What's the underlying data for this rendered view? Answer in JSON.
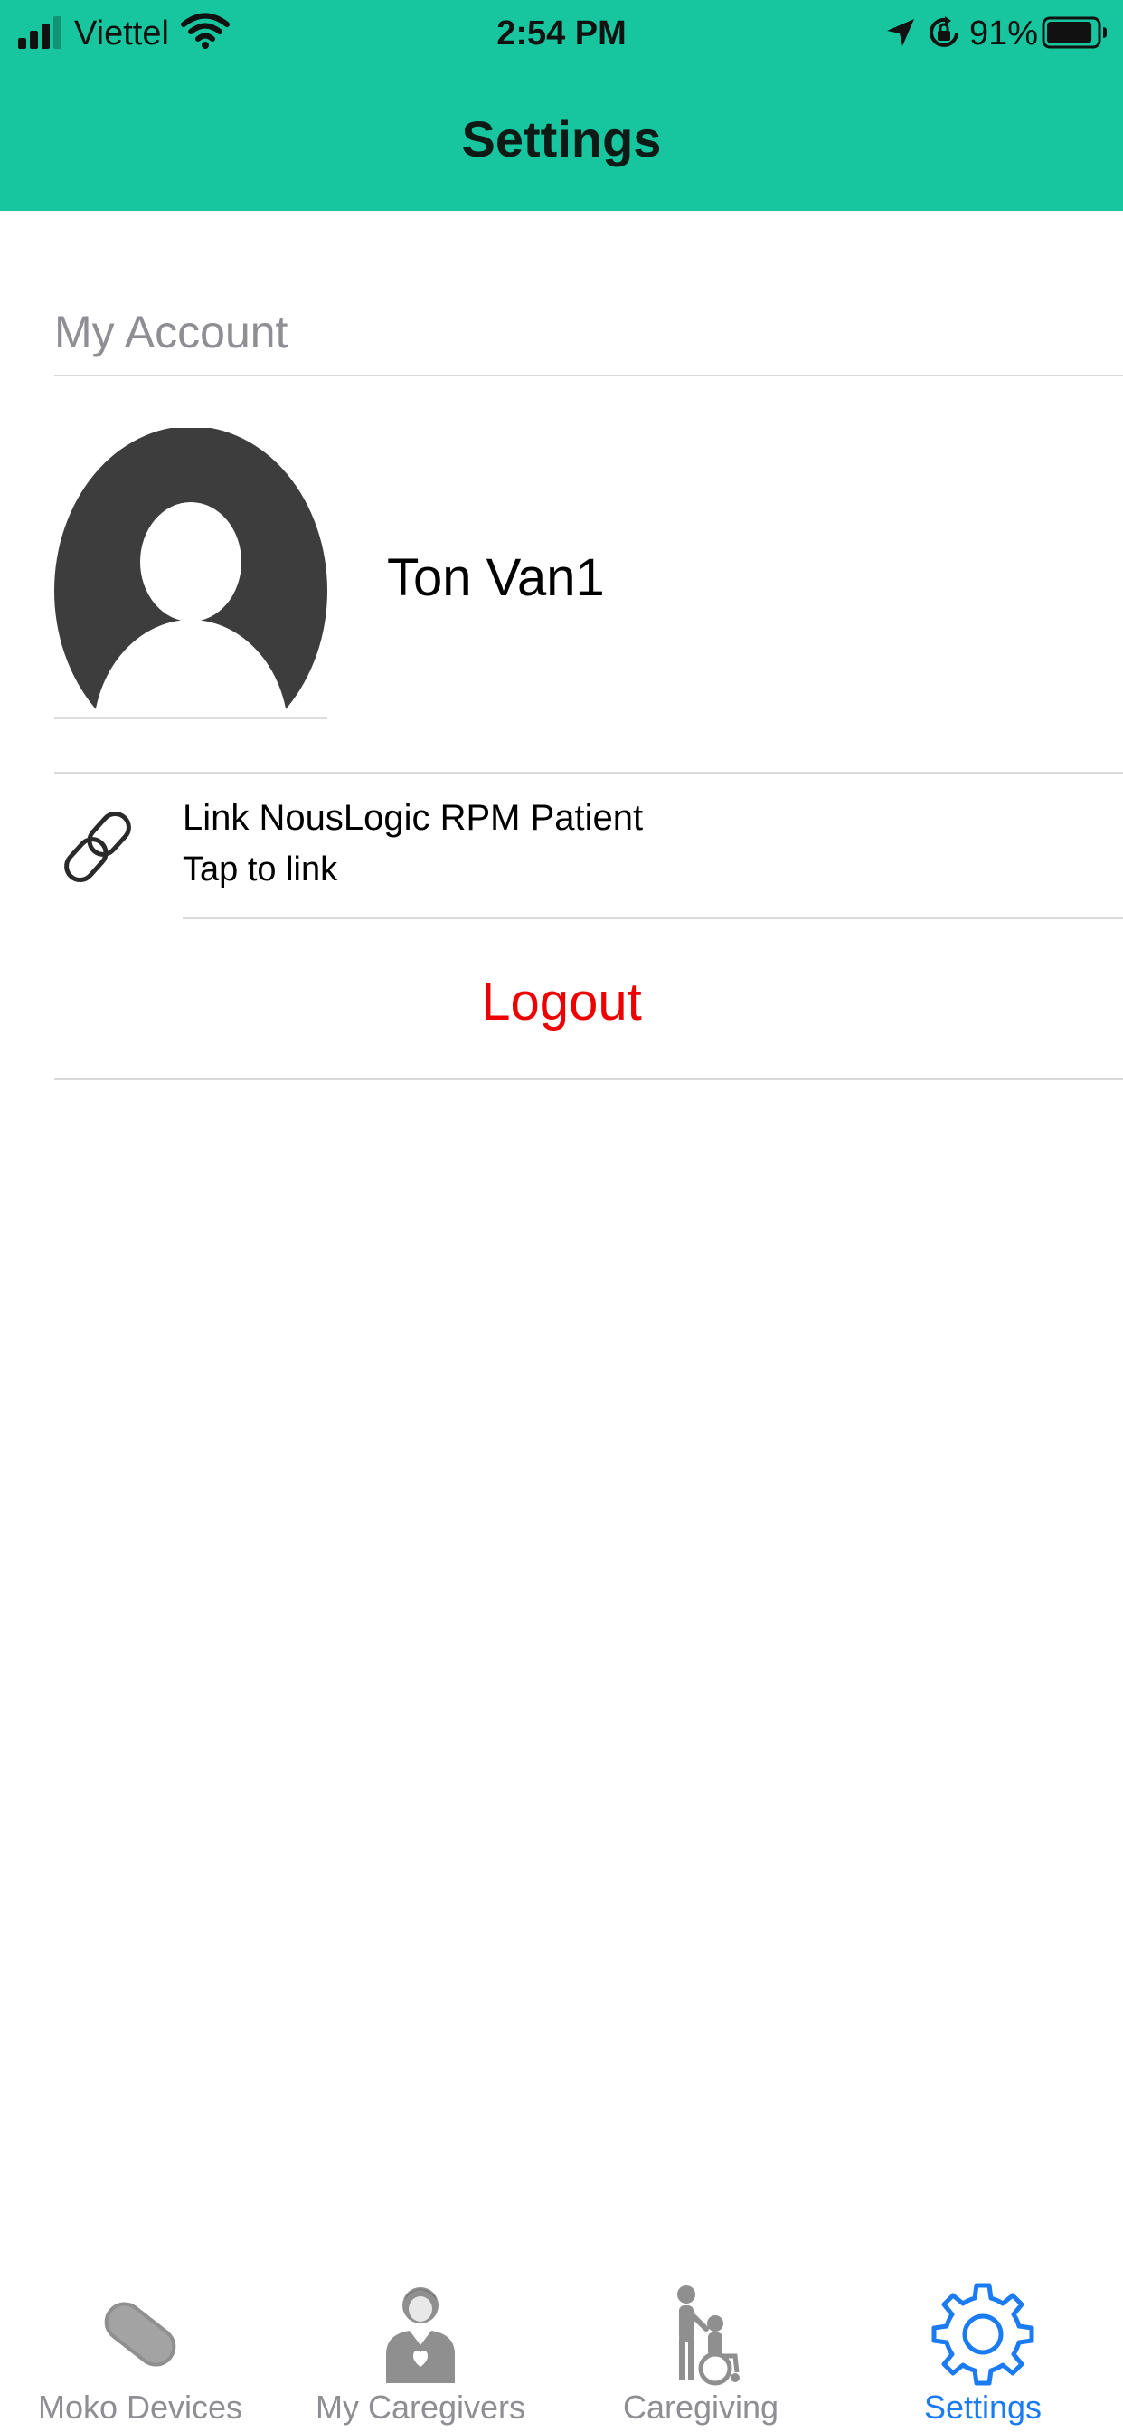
{
  "status_bar": {
    "carrier": "Viettel",
    "time": "2:54 PM",
    "battery_percent": "91%",
    "battery_level": 0.91,
    "signal_bars": 3,
    "signal_bars_total": 4,
    "icons": [
      "signal-icon",
      "wifi-icon",
      "location-arrow-icon",
      "orientation-lock-icon",
      "battery-icon"
    ]
  },
  "header": {
    "title": "Settings"
  },
  "account": {
    "section_title": "My Account",
    "profile_name": "Ton Van1",
    "avatar_icon": "avatar-placeholder-icon"
  },
  "link_row": {
    "title": "Link NousLogic RPM Patient",
    "subtitle": "Tap to link",
    "icon": "chain-link-icon"
  },
  "logout_label": "Logout",
  "tab_bar": {
    "tabs": [
      {
        "label": "Moko Devices",
        "icon": "device-icon",
        "active": false
      },
      {
        "label": "My Caregivers",
        "icon": "caregiver-icon",
        "active": false
      },
      {
        "label": "Caregiving",
        "icon": "wheelchair-icon",
        "active": false
      },
      {
        "label": "Settings",
        "icon": "gear-icon",
        "active": true
      }
    ]
  },
  "colors": {
    "header_bg": "#17c69e",
    "logout": "#ee0000",
    "tab_active": "#1a7bf2",
    "tab_inactive": "#8e8e93",
    "section_title": "#8e8e93",
    "avatar": "#3d3d3d"
  }
}
